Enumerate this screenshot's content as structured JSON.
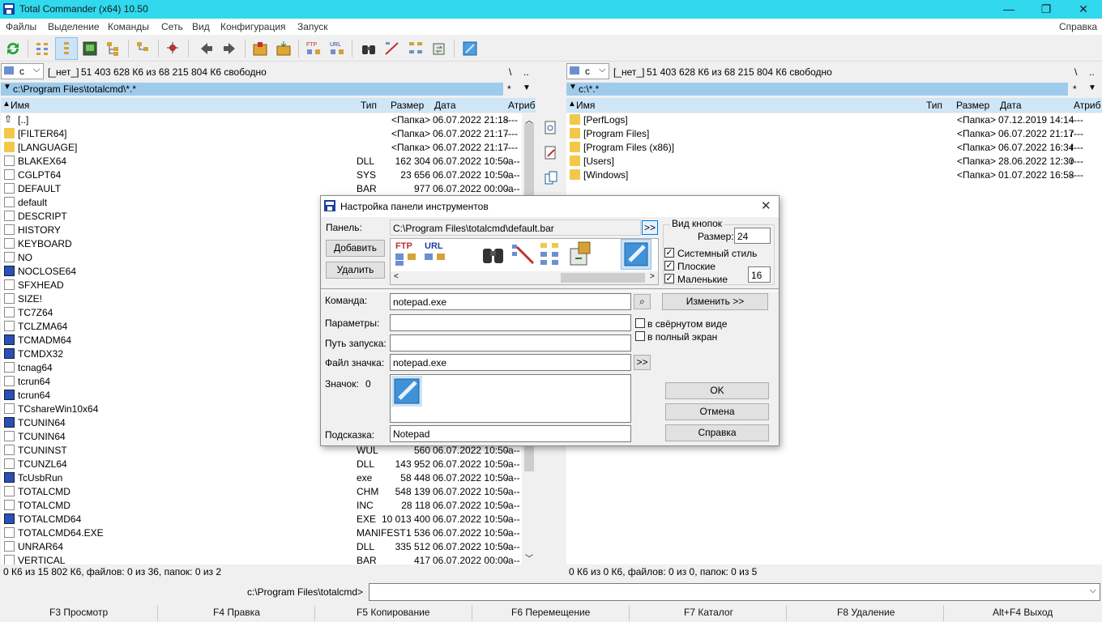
{
  "window": {
    "title": "Total Commander (x64) 10.50",
    "controls": [
      "—",
      "❐",
      "✕"
    ]
  },
  "menu": {
    "items": [
      "Файлы",
      "Выделение",
      "Команды",
      "Сеть",
      "Вид",
      "Конфигурация",
      "Запуск"
    ],
    "help": "Справка"
  },
  "toolbar": {
    "buttons": [
      "refresh-icon",
      "brief-view-icon",
      "detailed-view-icon",
      "thumbnails-icon",
      "tree-icon",
      "invert-selection-icon",
      "back-icon",
      "forward-icon",
      "pack-icon",
      "unpack-icon",
      "ftp-connect-icon",
      "url-connect-icon",
      "search-icon",
      "multi-rename-icon",
      "compare-dirs-icon",
      "sync-dirs-icon",
      "notepad-icon"
    ]
  },
  "left_panel": {
    "drive": "c",
    "drive_label": "[_нет_]",
    "free": "51 403 628 К6 из 68 215 804 К6 свободно",
    "root_btn": "\\",
    "up_btn": "..",
    "path": "c:\\Program Files\\totalcmd\\*.*",
    "star": "*",
    "headers": {
      "name": "Имя",
      "type": "Тип",
      "size": "Размер",
      "date": "Дата",
      "attr": "Атриб"
    },
    "rows": [
      {
        "name": "[..]",
        "type": "",
        "size": "<Папка>",
        "date": "06.07.2022 21:18",
        "attr": "----",
        "icon": "up"
      },
      {
        "name": "[FILTER64]",
        "type": "",
        "size": "<Папка>",
        "date": "06.07.2022 21:17",
        "attr": "----",
        "icon": "folder"
      },
      {
        "name": "[LANGUAGE]",
        "type": "",
        "size": "<Папка>",
        "date": "06.07.2022 21:17",
        "attr": "----",
        "icon": "folder"
      },
      {
        "name": "BLAKEX64",
        "type": "DLL",
        "size": "162 304",
        "date": "06.07.2022 10:50",
        "attr": "-a--",
        "icon": "dll"
      },
      {
        "name": "CGLPT64",
        "type": "SYS",
        "size": "23 656",
        "date": "06.07.2022 10:50",
        "attr": "-a--",
        "icon": "doc"
      },
      {
        "name": "DEFAULT",
        "type": "BAR",
        "size": "977",
        "date": "06.07.2022 00:00",
        "attr": "-a--",
        "icon": "doc"
      },
      {
        "name": "default",
        "type": "",
        "size": "",
        "date": "",
        "attr": "",
        "icon": "doc"
      },
      {
        "name": "DESCRIPT",
        "type": "",
        "size": "",
        "date": "",
        "attr": "",
        "icon": "doc"
      },
      {
        "name": "HISTORY",
        "type": "",
        "size": "",
        "date": "",
        "attr": "",
        "icon": "doc"
      },
      {
        "name": "KEYBOARD",
        "type": "",
        "size": "",
        "date": "",
        "attr": "",
        "icon": "doc"
      },
      {
        "name": "NO",
        "type": "",
        "size": "",
        "date": "",
        "attr": "",
        "icon": "doc"
      },
      {
        "name": "NOCLOSE64",
        "type": "",
        "size": "",
        "date": "",
        "attr": "",
        "icon": "exe"
      },
      {
        "name": "SFXHEAD",
        "type": "",
        "size": "",
        "date": "",
        "attr": "",
        "icon": "doc"
      },
      {
        "name": "SIZE!",
        "type": "",
        "size": "",
        "date": "",
        "attr": "",
        "icon": "doc"
      },
      {
        "name": "TC7Z64",
        "type": "",
        "size": "",
        "date": "",
        "attr": "",
        "icon": "dll"
      },
      {
        "name": "TCLZMA64",
        "type": "",
        "size": "",
        "date": "",
        "attr": "",
        "icon": "dll"
      },
      {
        "name": "TCMADM64",
        "type": "",
        "size": "",
        "date": "",
        "attr": "",
        "icon": "exe"
      },
      {
        "name": "TCMDX32",
        "type": "",
        "size": "",
        "date": "",
        "attr": "",
        "icon": "exe"
      },
      {
        "name": "tcnag64",
        "type": "",
        "size": "",
        "date": "",
        "attr": "",
        "icon": "dll"
      },
      {
        "name": "tcrun64",
        "type": "",
        "size": "",
        "date": "",
        "attr": "",
        "icon": "doc"
      },
      {
        "name": "tcrun64",
        "type": "",
        "size": "",
        "date": "",
        "attr": "",
        "icon": "exe"
      },
      {
        "name": "TCshareWin10x64",
        "type": "",
        "size": "",
        "date": "",
        "attr": "",
        "icon": "doc"
      },
      {
        "name": "TCUNIN64",
        "type": "",
        "size": "",
        "date": "",
        "attr": "",
        "icon": "exe"
      },
      {
        "name": "TCUNIN64",
        "type": "",
        "size": "",
        "date": "",
        "attr": "",
        "icon": "doc"
      },
      {
        "name": "TCUNINST",
        "type": "WUL",
        "size": "560",
        "date": "06.07.2022 10:50",
        "attr": "-a--",
        "icon": "doc"
      },
      {
        "name": "TCUNZL64",
        "type": "DLL",
        "size": "143 952",
        "date": "06.07.2022 10:50",
        "attr": "-a--",
        "icon": "dll"
      },
      {
        "name": "TcUsbRun",
        "type": "exe",
        "size": "58 448",
        "date": "06.07.2022 10:50",
        "attr": "-a--",
        "icon": "exe"
      },
      {
        "name": "TOTALCMD",
        "type": "CHM",
        "size": "548 139",
        "date": "06.07.2022 10:50",
        "attr": "-a--",
        "icon": "doc"
      },
      {
        "name": "TOTALCMD",
        "type": "INC",
        "size": "28 118",
        "date": "06.07.2022 10:50",
        "attr": "-a--",
        "icon": "doc"
      },
      {
        "name": "TOTALCMD64",
        "type": "EXE",
        "size": "10 013 400",
        "date": "06.07.2022 10:50",
        "attr": "-a--",
        "icon": "exe"
      },
      {
        "name": "TOTALCMD64.EXE",
        "type": "MANIFEST",
        "size": "1 536",
        "date": "06.07.2022 10:50",
        "attr": "-a--",
        "icon": "doc"
      },
      {
        "name": "UNRAR64",
        "type": "DLL",
        "size": "335 512",
        "date": "06.07.2022 10:50",
        "attr": "-a--",
        "icon": "dll"
      },
      {
        "name": "VERTICAL",
        "type": "BAR",
        "size": "417",
        "date": "06.07.2022 00:00",
        "attr": "-a--",
        "icon": "doc"
      }
    ],
    "status": "0 К6 из 15 802 К6, файлов: 0 из 36, папок: 0 из 2"
  },
  "right_panel": {
    "drive": "c",
    "drive_label": "[_нет_]",
    "free": "51 403 628 К6 из 68 215 804 К6 свободно",
    "root_btn": "\\",
    "up_btn": "..",
    "path": "c:\\*.*",
    "star": "*",
    "headers": {
      "name": "Имя",
      "type": "Тип",
      "size": "Размер",
      "date": "Дата",
      "attr": "Атриб"
    },
    "rows": [
      {
        "name": "[PerfLogs]",
        "size": "<Папка>",
        "date": "07.12.2019 14:14",
        "attr": "----"
      },
      {
        "name": "[Program Files]",
        "size": "<Папка>",
        "date": "06.07.2022 21:17",
        "attr": "r---"
      },
      {
        "name": "[Program Files (x86)]",
        "size": "<Папка>",
        "date": "06.07.2022 16:34",
        "attr": "r---"
      },
      {
        "name": "[Users]",
        "size": "<Папка>",
        "date": "28.06.2022 12:30",
        "attr": "r---"
      },
      {
        "name": "[Windows]",
        "size": "<Папка>",
        "date": "01.07.2022 16:58",
        "attr": "----"
      }
    ],
    "status": "0 К6 из 0 К6, файлов: 0 из 0, папок: 0 из 5"
  },
  "dialog": {
    "title": "Настройка панели инструментов",
    "panel_label": "Панель:",
    "panel_value": "C:\\Program Files\\totalcmd\\default.bar",
    "browse": ">>",
    "add": "Добавить",
    "delete": "Удалить",
    "view_group": "Вид кнопок",
    "size_label": "Размер:",
    "size_value": "24",
    "system_style": "Системный стиль",
    "flat": "Плоские",
    "small": "Маленькие",
    "small_value": "16",
    "command_label": "Команда:",
    "command_value": "notepad.exe",
    "change": "Изменить >>",
    "params_label": "Параметры:",
    "params_value": "",
    "minimized": "в свёрнутом виде",
    "fullscreen": "в полный экран",
    "startpath_label": "Путь запуска:",
    "startpath_value": "",
    "iconfile_label": "Файл значка:",
    "iconfile_value": "notepad.exe",
    "icon_label": "Значок:",
    "icon_index": "0",
    "tooltip_label": "Подсказка:",
    "tooltip_value": "Notepad",
    "ok": "OK",
    "cancel": "Отмена",
    "help": "Справка",
    "strip_ftp": "FTP",
    "strip_url": "URL"
  },
  "cmdline": {
    "prompt": "c:\\Program Files\\totalcmd>",
    "value": ""
  },
  "fkeys": [
    "F3 Просмотр",
    "F4 Правка",
    "F5 Копирование",
    "F6 Перемещение",
    "F7 Каталог",
    "F8 Удаление",
    "Alt+F4 Выход"
  ]
}
